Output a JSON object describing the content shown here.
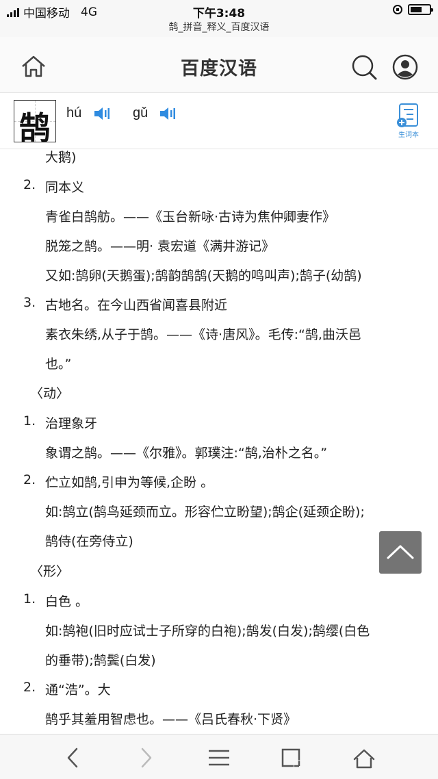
{
  "status_bar": {
    "carrier": "中国移动",
    "network": "4G",
    "time": "下午3:48",
    "icons": [
      "signal-icon",
      "orientation-lock-icon",
      "battery-icon"
    ]
  },
  "url_bar": {
    "title": "鹄_拼音_释义_百度汉语"
  },
  "header": {
    "title": "百度汉语",
    "icons": [
      "home-icon",
      "search-icon",
      "user-icon"
    ]
  },
  "word": {
    "character": "鹄",
    "pinyin": [
      {
        "text": "hú",
        "icon": "sound-icon"
      },
      {
        "text": "gǔ",
        "icon": "sound-icon"
      }
    ],
    "notebook_label": "生词本"
  },
  "content": {
    "top_fragment": "大鹅)",
    "noun_items": [
      {
        "num": "2.",
        "def": "同本义",
        "examples": [
          "青雀白鹄舫。——《玉台新咏·古诗为焦仲卿妻作》",
          "脱笼之鹄。——明· 袁宏道《满井游记》",
          "又如:鹄卵(天鹅蛋);鹄韵鹄鹄(天鹅的鸣叫声);鹄子(幼鹄)"
        ]
      },
      {
        "num": "3.",
        "def": "古地名。在今山西省闻喜县附近",
        "examples": [
          "素衣朱绣,从子于鹄。——《诗·唐风》。毛传:“鹄,曲沃邑",
          "也。”"
        ]
      }
    ],
    "verb_label": "〈动〉",
    "verb_items": [
      {
        "num": "1.",
        "def": "治理象牙",
        "examples": [
          "象谓之鹄。——《尔雅》。郭璞注:“鹄,治朴之名。”"
        ]
      },
      {
        "num": "2.",
        "def": "伫立如鹄,引申为等候,企盼 。",
        "examples": [
          "如:鹄立(鹄鸟延颈而立。形容伫立盼望);鹄企(延颈企盼);",
          "鹄侍(在旁侍立)"
        ]
      }
    ],
    "adj_label": "〈形〉",
    "adj_items": [
      {
        "num": "1.",
        "def": "白色 。",
        "examples": [
          "如:鹄袍(旧时应试士子所穿的白袍);鹄发(白发);鹄缨(白色",
          "的垂带);鹄鬓(白发)"
        ]
      },
      {
        "num": "2.",
        "def": "通“浩”。大",
        "examples": [
          "鹄乎其羞用智虑也。——《吕氏春秋·下贤》"
        ]
      }
    ]
  },
  "scroll_top": {
    "icon": "chevron-up-icon"
  },
  "toolbar": {
    "buttons": [
      "back-icon",
      "forward-icon",
      "menu-icon",
      "tabs-icon",
      "home-icon"
    ]
  },
  "colors": {
    "accent_blue": "#2f8be0",
    "text": "#222222",
    "scroll_button": "#666666"
  }
}
